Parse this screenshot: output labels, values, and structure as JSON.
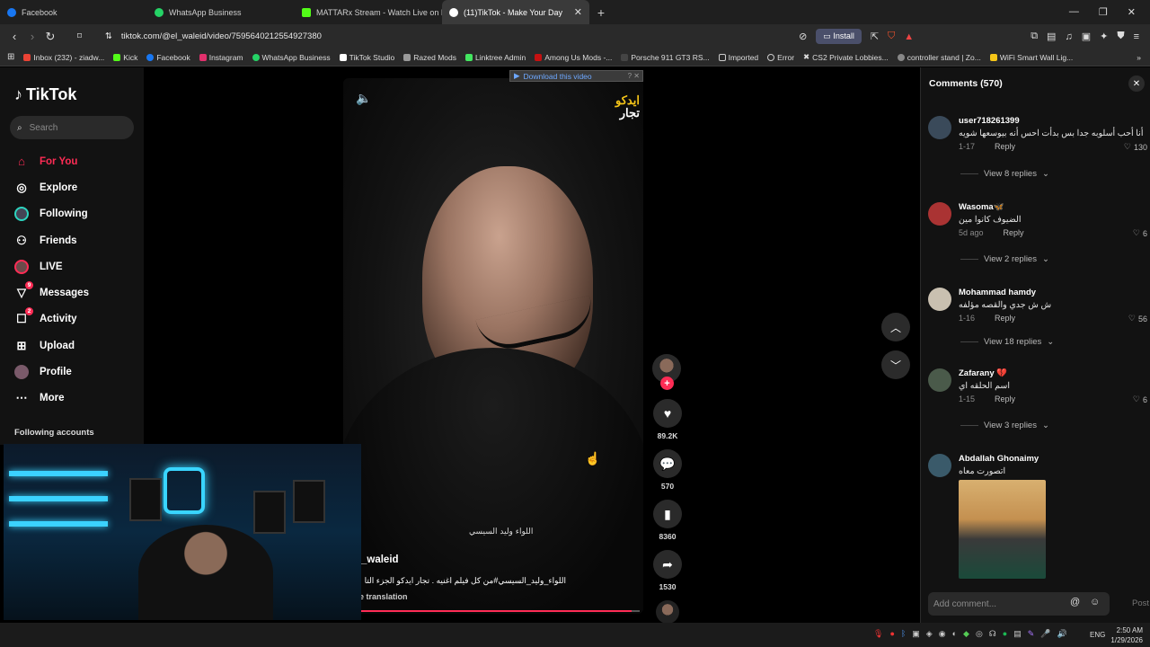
{
  "browser": {
    "tabs": [
      {
        "label": "Facebook",
        "color": "#1877f2",
        "active": false
      },
      {
        "label": "WhatsApp Business",
        "color": "#25d366",
        "active": false
      },
      {
        "label": "MATTARx Stream - Watch Live on Kick",
        "color": "#53fc18",
        "active": false
      },
      {
        "label": "(11)TikTok - Make Your Day",
        "color": "#ffffff",
        "active": true
      }
    ],
    "url": "tiktok.com/@el_waleid/video/7595640212554927380",
    "install_label": "Install",
    "bookmarks": [
      {
        "label": "Inbox (232) - ziadw...",
        "color": "#ea4335"
      },
      {
        "label": "Kick",
        "color": "#53fc18"
      },
      {
        "label": "Facebook",
        "color": "#1877f2"
      },
      {
        "label": "Instagram",
        "color": "#e1306c"
      },
      {
        "label": "WhatsApp Business",
        "color": "#25d366"
      },
      {
        "label": "TikTok Studio",
        "color": "#ffffff"
      },
      {
        "label": "Razed Mods",
        "color": "#999999"
      },
      {
        "label": "Linktree Admin",
        "color": "#43e660"
      },
      {
        "label": "Among Us Mods -...",
        "color": "#c51111"
      },
      {
        "label": "Porsche 911 GT3 RS...",
        "color": "#444444"
      },
      {
        "label": "Imported",
        "color": "#cccccc"
      },
      {
        "label": "Error",
        "color": "#cccccc"
      },
      {
        "label": "CS2 Private Lobbies...",
        "color": "#ffffff"
      },
      {
        "label": "controller stand | Zo...",
        "color": "#888888"
      },
      {
        "label": "WiFi Smart Wall Lig...",
        "color": "#f5c518"
      }
    ]
  },
  "sidebar": {
    "logo": "TikTok",
    "search_placeholder": "Search",
    "items": [
      {
        "label": "For You",
        "icon": "home-icon",
        "active": true
      },
      {
        "label": "Explore",
        "icon": "compass-icon"
      },
      {
        "label": "Following",
        "icon": "following-avatar-icon"
      },
      {
        "label": "Friends",
        "icon": "friends-icon"
      },
      {
        "label": "LIVE",
        "icon": "live-avatar-icon"
      },
      {
        "label": "Messages",
        "icon": "messages-icon",
        "badge": "9"
      },
      {
        "label": "Activity",
        "icon": "activity-icon",
        "badge": "2"
      },
      {
        "label": "Upload",
        "icon": "upload-icon"
      },
      {
        "label": "Profile",
        "icon": "profile-avatar-icon"
      },
      {
        "label": "More",
        "icon": "more-icon"
      }
    ],
    "following_header": "Following accounts"
  },
  "video": {
    "download_label": "Download this video",
    "watermark_line1": "ايدكو",
    "watermark_line2": "تجار",
    "signature": "اللواء وليد السيسي",
    "username": "_waleid",
    "caption": "اللواء_وليد_السيسي#من كل فيلم اغنيه . تجار ايدكو الجزء التا",
    "see_translation": "e translation",
    "progress": 0.97
  },
  "actions": {
    "likes": "89.2K",
    "comments": "570",
    "saves": "8360",
    "shares": "1530"
  },
  "comments_panel": {
    "title": "Comments (570)",
    "items": [
      {
        "user": "user718261399",
        "text": "أنا أحب أسلوبه جدا بس بدأت احس أنه بيوسعها شويه",
        "date": "1-17",
        "reply": "Reply",
        "likes": "130",
        "replies": "View 8 replies",
        "avatar_color": "#3a4a5a"
      },
      {
        "user": "Wasoma🦋",
        "text": "الضيوف كانوا مين",
        "date": "5d ago",
        "reply": "Reply",
        "likes": "6",
        "replies": "View 2 replies",
        "avatar_color": "#a33"
      },
      {
        "user": "Mohammad hamdy",
        "text": "ش ش جدي والقصه مؤلفه",
        "date": "1-16",
        "reply": "Reply",
        "likes": "56",
        "replies": "View 18 replies",
        "avatar_color": "#c9c0b0"
      },
      {
        "user": "Zafarany 💔",
        "text": "اسم الحلقه اي",
        "date": "1-15",
        "reply": "Reply",
        "likes": "6",
        "replies": "View 3 replies",
        "avatar_color": "#4a5a4a"
      },
      {
        "user": "Abdallah Ghonaimy",
        "text": "اتصورت معاه",
        "date": "",
        "reply": "",
        "likes": "",
        "replies": "",
        "avatar_color": "#3a5a6a"
      }
    ],
    "input_placeholder": "Add comment...",
    "post_label": "Post"
  },
  "taskbar": {
    "lang": "ENG",
    "time": "2:50 AM",
    "date": "1/29/2026"
  }
}
